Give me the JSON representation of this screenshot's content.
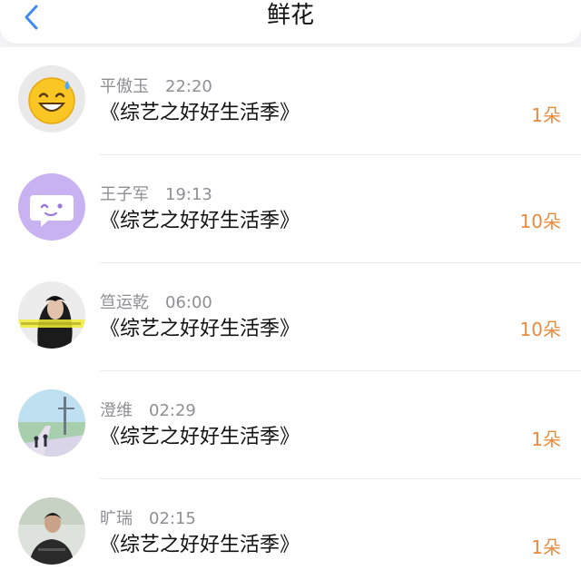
{
  "nav": {
    "title": "鲜花",
    "back_icon": "chevron-left-icon",
    "accent_color": "#3d8bf2"
  },
  "count_color": "#e88b3e",
  "rows": [
    {
      "name": "平傲玉",
      "time": "22:20",
      "show": "《综艺之好好生活季》",
      "count": "1朵",
      "avatar": "sweat-smile-emoji"
    },
    {
      "name": "王子军",
      "time": "19:13",
      "show": "《综艺之好好生活季》",
      "count": "10朵",
      "avatar": "chat-bubble-face"
    },
    {
      "name": "笪运乾",
      "time": "06:00",
      "show": "《综艺之好好生活季》",
      "count": "10朵",
      "avatar": "portrait-photo"
    },
    {
      "name": "澄维",
      "time": "02:29",
      "show": "《综艺之好好生活季》",
      "count": "1朵",
      "avatar": "anime-scenery"
    },
    {
      "name": "旷瑞",
      "time": "02:15",
      "show": "《综艺之好好生活季》",
      "count": "1朵",
      "avatar": "person-photo"
    }
  ]
}
